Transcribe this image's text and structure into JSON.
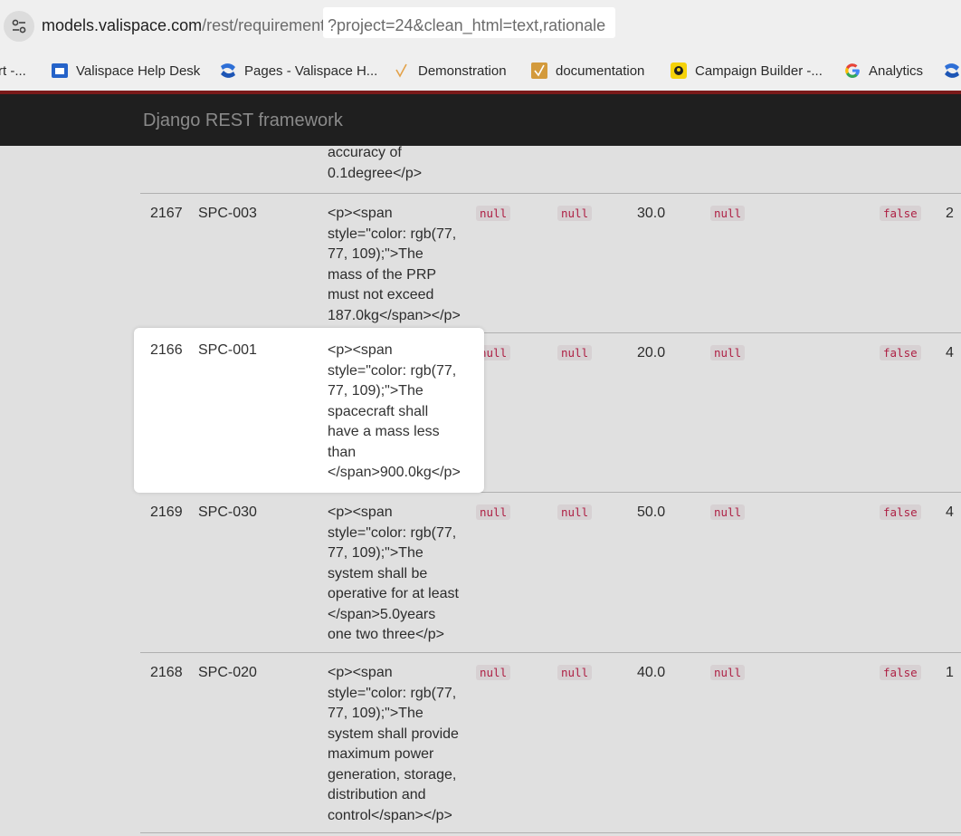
{
  "browser": {
    "url_host": "models.valispace.com",
    "url_path": "/rest/requirements/",
    "url_query": "?project=24&clean_html=text,rationale"
  },
  "bookmarks": [
    {
      "label": "rt -...",
      "icon": "partial-icon"
    },
    {
      "label": "Valispace Help Desk",
      "icon": "helpdesk-icon",
      "color": "#2563c9"
    },
    {
      "label": "Pages - Valispace H...",
      "icon": "confluence-icon",
      "color": "#2e6fd6"
    },
    {
      "label": "Demonstration",
      "icon": "check-icon",
      "color": "#e3a24a"
    },
    {
      "label": "documentation",
      "icon": "check-box-icon",
      "color": "#d39a3c"
    },
    {
      "label": "Campaign Builder -...",
      "icon": "mailchimp-icon",
      "color": "#f5d20a"
    },
    {
      "label": "Analytics",
      "icon": "google-icon"
    }
  ],
  "navbar": {
    "brand": "Django REST framework"
  },
  "table": {
    "partial_row": {
      "text_tail": "accuracy of\n0.1degree</p>"
    },
    "rows": [
      {
        "id": "2167",
        "code": "SPC-003",
        "text": "<p><span\nstyle=\"color: rgb(77,\n77, 109);\">The\nmass of the PRP\nmust not exceed\n187.0kg</span></p>",
        "n1": "null",
        "n2": "null",
        "value": "30.0",
        "n3": "null",
        "flag": "false",
        "last": "2"
      },
      {
        "id": "2166",
        "code": "SPC-001",
        "text": "<p><span\nstyle=\"color: rgb(77,\n77, 109);\">The\nspacecraft shall\nhave a mass less\nthan\n</span>900.0kg</p>",
        "n1": "null",
        "n2": "null",
        "value": "20.0",
        "n3": "null",
        "flag": "false",
        "last": "4"
      },
      {
        "id": "2169",
        "code": "SPC-030",
        "text": "<p><span\nstyle=\"color: rgb(77,\n77, 109);\">The\nsystem shall be\noperative for at least\n</span>5.0years\none two three</p>",
        "n1": "null",
        "n2": "null",
        "value": "50.0",
        "n3": "null",
        "flag": "false",
        "last": "4"
      },
      {
        "id": "2168",
        "code": "SPC-020",
        "text": "<p><span\nstyle=\"color: rgb(77,\n77, 109);\">The\nsystem shall provide\nmaximum power\ngeneration, storage,\ndistribution and\ncontrol</span></p>",
        "n1": "null",
        "n2": "null",
        "value": "40.0",
        "n3": "null",
        "flag": "false",
        "last": "1"
      }
    ]
  }
}
